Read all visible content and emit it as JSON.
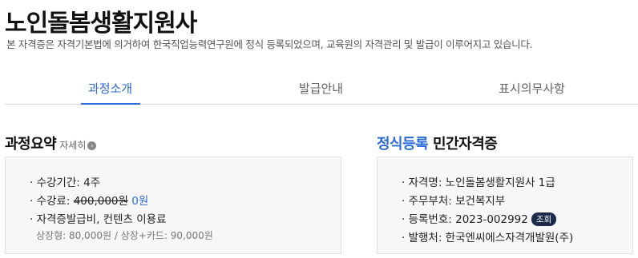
{
  "header": {
    "title": "노인돌봄생활지원사",
    "subtitle": "본 자격증은 자격기본법에 의거하여 한국직업능력연구원에 정식 등록되었으며, 교육원의 자격관리 및 발급이 이루어지고 있습니다."
  },
  "tabs": [
    {
      "label": "과정소개"
    },
    {
      "label": "발급안내"
    },
    {
      "label": "표시의무사항"
    }
  ],
  "summary": {
    "title": "과정요약",
    "detail_link": "자세히",
    "period": "· 수강기간: 4주",
    "fee_label": "· 수강료: ",
    "fee_original": "400,000원",
    "fee_current": "0원",
    "extra": "· 자격증발급비, 컨텐츠 이용료",
    "extra_detail": "상장형: 80,000원 / 상장+카드: 90,000원"
  },
  "registration": {
    "title_highlight": "정식등록",
    "title_rest": "민간자격증",
    "name": "· 자격명: 노인돌봄생활지원사 1급",
    "ministry": "· 주무부처: 보건복지부",
    "reg_number": "· 등록번호: 2023-002992",
    "lookup_badge": "조회",
    "issuer": "· 발행처: 한국엔씨에스자격개발원(주)"
  }
}
